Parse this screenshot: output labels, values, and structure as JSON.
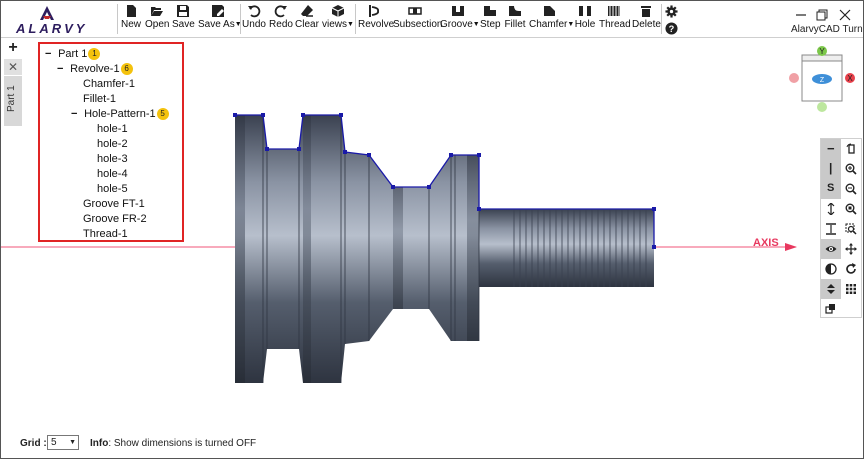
{
  "app": {
    "logo_text": "ALARVY",
    "title": "AlarvyCAD Turn"
  },
  "toolbar": {
    "new": "New",
    "open": "Open",
    "save": "Save",
    "save_as": "Save As",
    "undo": "Undo",
    "redo": "Redo",
    "clear": "Clear",
    "views": "views",
    "revolve": "Revolve",
    "subsection": "Subsection",
    "groove": "Groove",
    "step": "Step",
    "fillet": "Fillet",
    "chamfer": "Chamfer",
    "hole": "Hole",
    "thread": "Thread",
    "delete": "Delete"
  },
  "left_tabs": {
    "add": "+",
    "close": "✕",
    "part": "Part 1"
  },
  "tree": {
    "part": {
      "label": "Part 1",
      "count": "1",
      "toggle": "−"
    },
    "revolve": {
      "label": "Revolve-1",
      "count": "6",
      "toggle": "−"
    },
    "chamfer": "Chamfer-1",
    "fillet": "Fillet-1",
    "hole_pattern": {
      "label": "Hole-Pattern-1",
      "count": "5",
      "toggle": "−"
    },
    "holes": [
      "hole-1",
      "hole-2",
      "hole-3",
      "hole-4",
      "hole-5"
    ],
    "groove_ft": "Groove FT-1",
    "groove_fr": "Groove FR-2",
    "thread": "Thread-1"
  },
  "viewport": {
    "axis_label": "AXIS",
    "axis_color": "#e8385f",
    "part_color": "#4b5566",
    "outline_color": "#1a1aa8"
  },
  "navcube": {
    "y_label": "Y",
    "x_label": "X",
    "z_label": "Z",
    "y_color": "#7cc84a",
    "x_color": "#e8414b",
    "z_color": "#3e8fd8"
  },
  "toolbox": {
    "item_1": "−",
    "item_2": "|",
    "item_3": "S"
  },
  "status": {
    "grid_label": "Grid :",
    "grid_value": "5",
    "info_label": "Info",
    "info_text": ": Show dimensions is turned OFF"
  }
}
